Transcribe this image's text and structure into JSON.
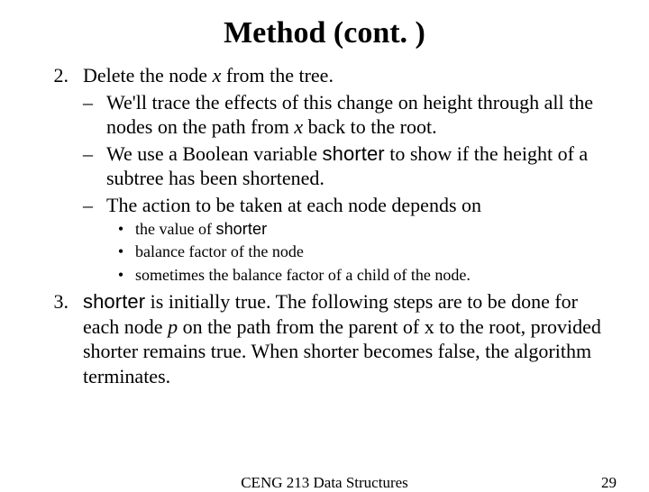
{
  "title": "Method (cont. )",
  "item2": {
    "num": "2.",
    "text_a": "Delete the node ",
    "text_x": "x",
    "text_b": " from the tree.",
    "sub1_a": "We'll trace the effects of this change on height through all the nodes on the path from ",
    "sub1_x": "x",
    "sub1_b": " back to the root.",
    "sub2_a": "We use a Boolean variable ",
    "sub2_code": "shorter",
    "sub2_b": " to show if the height of a subtree has been shortened.",
    "sub3": "The action to be taken at each node depends on",
    "bul1_a": "the value of ",
    "bul1_code": "shorter",
    "bul2": "balance factor of the node",
    "bul3": "sometimes the balance factor of a child of the node."
  },
  "item3": {
    "num": "3.",
    "code": "shorter",
    "text_a": " is initially true. The following steps are to be done for each node ",
    "text_p": "p",
    "text_b": " on the path from the parent of x to the root, provided shorter remains true. When shorter becomes false, the algorithm terminates."
  },
  "footer_center": "CENG 213 Data Structures",
  "footer_right": "29",
  "dash": "–",
  "bullet": "•"
}
